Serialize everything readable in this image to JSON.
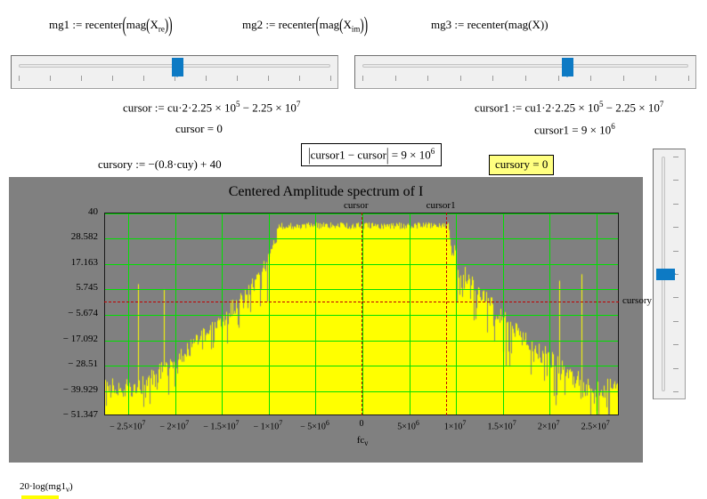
{
  "definitions": [
    {
      "id": "mg1",
      "lhs": "mg1",
      "op": ":=",
      "fn": "recenter",
      "inner": "mag",
      "arg": "X",
      "argsub": "re"
    },
    {
      "id": "mg2",
      "lhs": "mg2",
      "op": ":=",
      "fn": "recenter",
      "inner": "mag",
      "arg": "X",
      "argsub": "im"
    },
    {
      "id": "mg3",
      "lhs": "mg3",
      "op": ":=",
      "fn": "recenter",
      "inner": "mag",
      "arg": "X",
      "argsub": ""
    }
  ],
  "sliders": {
    "left": {
      "name": "cu-slider",
      "value_fraction": 0.51,
      "tick_count": 11
    },
    "right": {
      "name": "cu1-slider",
      "value_fraction": 0.63,
      "tick_count": 11
    },
    "vertical": {
      "name": "cuy-slider",
      "value_fraction": 0.5,
      "tick_count": 11
    }
  },
  "cursor": {
    "def_lhs": "cursor",
    "def_op": ":=",
    "def_rhs_a": "cu·2·2.25 × 10",
    "def_rhs_a_exp": "5",
    "def_rhs_b": " − 2.25 × 10",
    "def_rhs_b_exp": "7",
    "value_lhs": "cursor",
    "value_eq": "=",
    "value": "0"
  },
  "cursor1": {
    "def_lhs": "cursor1",
    "def_op": ":=",
    "def_rhs_a": "cu1·2·2.25 × 10",
    "def_rhs_a_exp": "5",
    "def_rhs_b": " − 2.25 × 10",
    "def_rhs_b_exp": "7",
    "value_lhs": "cursor1",
    "value_eq": "=",
    "value": "9 × 10",
    "value_exp": "6"
  },
  "cursory": {
    "def_lhs": "cursory",
    "def_op": ":=",
    "def_rhs": "−(0.8·cuy) + 40",
    "box_text": "cursory = 0",
    "box_bg": "#ffff80"
  },
  "difference_box": {
    "expr_lhs": "cursor1 − cursor",
    "eq": "=",
    "value": "9 × 10",
    "value_exp": "6"
  },
  "chart_data": {
    "type": "line",
    "title": "Centered Amplitude spectrum of I",
    "xlabel": "fc",
    "xlabel_sub": "ν",
    "ylabel": "20·log(mg1",
    "ylabel_sub": "ν",
    "ylabel_close": ")",
    "trace_color": "#ffff00",
    "grid": true,
    "grid_color": "#00e000",
    "plot_bg": "#808080",
    "xlim": [
      -27500000,
      27500000
    ],
    "ylim": [
      -51.347,
      40
    ],
    "yticks": [
      40,
      28.582,
      17.163,
      5.745,
      -5.674,
      -17.092,
      -28.51,
      -39.929,
      -51.347
    ],
    "ytick_labels": [
      "40",
      "28.582",
      "17.163",
      "5.745",
      "− 5.674",
      "− 17.092",
      "− 28.51",
      "− 39.929",
      "− 51.347"
    ],
    "xticks": [
      -25000000,
      -20000000,
      -15000000,
      -10000000,
      -5000000,
      0,
      5000000,
      10000000,
      15000000,
      20000000,
      25000000
    ],
    "xtick_labels": [
      "− 2.5×10⁷",
      "− 2×10⁷",
      "− 1.5×10⁷",
      "− 1×10⁷",
      "− 5×10⁶",
      "0",
      "5×10⁶",
      "1×10⁷",
      "1.5×10⁷",
      "2×10⁷",
      "2.5×10⁷"
    ],
    "annotations": [
      {
        "name": "cursor",
        "type": "vline",
        "x": 0,
        "label": "cursor",
        "color": "#c00000",
        "style": "dashed"
      },
      {
        "name": "cursor1",
        "type": "vline",
        "x": 9000000,
        "label": "cursor1",
        "color": "#c00000",
        "style": "dashed"
      },
      {
        "name": "cursory",
        "type": "hline",
        "y": 0,
        "label": "cursory",
        "color": "#c00000",
        "style": "dashed"
      }
    ],
    "signal_band": {
      "start": -9200000,
      "end": 9200000,
      "top_db": 36,
      "skirt_db": 2
    },
    "noise_floor_db": -34,
    "description": "Centered amplitude spectrum: flat passband approx +34 dB between -9.2e6 and +9.2e6 Hz, sloping shoulders down to a noise floor near -34 dB at the band edges."
  }
}
